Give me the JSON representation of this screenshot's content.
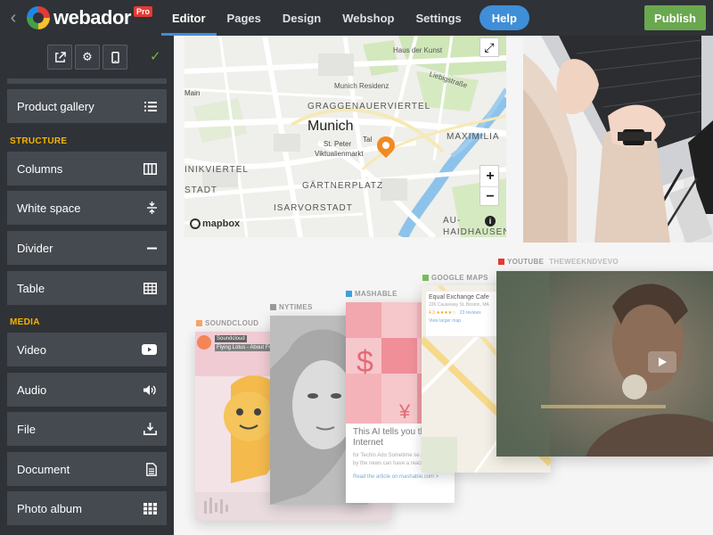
{
  "brand": {
    "name": "webador",
    "badge": "Pro"
  },
  "nav": {
    "back_icon": "chevron-left-icon",
    "tabs": [
      {
        "label": "Editor",
        "active": true
      },
      {
        "label": "Pages"
      },
      {
        "label": "Design"
      },
      {
        "label": "Webshop"
      },
      {
        "label": "Settings"
      }
    ],
    "help": "Help",
    "publish": "Publish"
  },
  "toolbar": {
    "buttons": [
      "external-link-icon",
      "gear-icon",
      "mobile-icon"
    ],
    "confirm": "✓"
  },
  "sidebar": {
    "items_top": [
      {
        "label": "Product gallery",
        "icon": "list-icon"
      }
    ],
    "structure_heading": "STRUCTURE",
    "structure": [
      {
        "label": "Columns",
        "icon": "columns-icon"
      },
      {
        "label": "White space",
        "icon": "white-space-icon"
      },
      {
        "label": "Divider",
        "icon": "divider-icon"
      },
      {
        "label": "Table",
        "icon": "table-icon"
      }
    ],
    "media_heading": "MEDIA",
    "media": [
      {
        "label": "Video",
        "icon": "youtube-icon"
      },
      {
        "label": "Audio",
        "icon": "speaker-icon"
      },
      {
        "label": "File",
        "icon": "download-icon"
      },
      {
        "label": "Document",
        "icon": "document-icon"
      },
      {
        "label": "Photo album",
        "icon": "grid-icon"
      }
    ]
  },
  "map": {
    "city": "Munich",
    "labels": {
      "haus": "Haus der Kunst",
      "residenz": "Munich Residenz",
      "liebig": "Liebigstraße",
      "gragg": "GRAGGENAUERVIERTEL",
      "maxim": "MAXIMILIA",
      "peter": "St. Peter",
      "vikt": "Viktualienmarkt",
      "nik": "INIKVIERTEL",
      "stadt": "STADT",
      "gart": "GÄRTNERPLATZ",
      "isar": "ISARVORSTADT",
      "au": "AU-",
      "haid": "HAIDHAUSEN",
      "main": "Main",
      "tal": "Tal"
    },
    "attribution": "mapbox"
  },
  "embeds": {
    "youtube": {
      "tag": "YOUTUBE",
      "channel": "THEWEEKNDVEVO"
    },
    "gmaps": {
      "tag": "GOOGLE MAPS",
      "place": "Equal Exchange Cafe",
      "address": "226 Causeway St, Boston, MA",
      "rating": "4.3 ★★★★☆",
      "reviews": "23 reviews",
      "link": "View larger map"
    },
    "mashable": {
      "tag": "MASHABLE",
      "headline": "This AI tells you the Internet",
      "snippet": "for Techin Ado Sometime se appointed by the news can have a reachart on ne",
      "link": "Read the article on mashable.com >"
    },
    "nytimes": {
      "tag": "NYTIMES"
    },
    "soundcloud": {
      "tag": "SOUNDCLOUD",
      "artist": "Soundcloud",
      "track": "Flying Lotus - About Fr"
    }
  }
}
